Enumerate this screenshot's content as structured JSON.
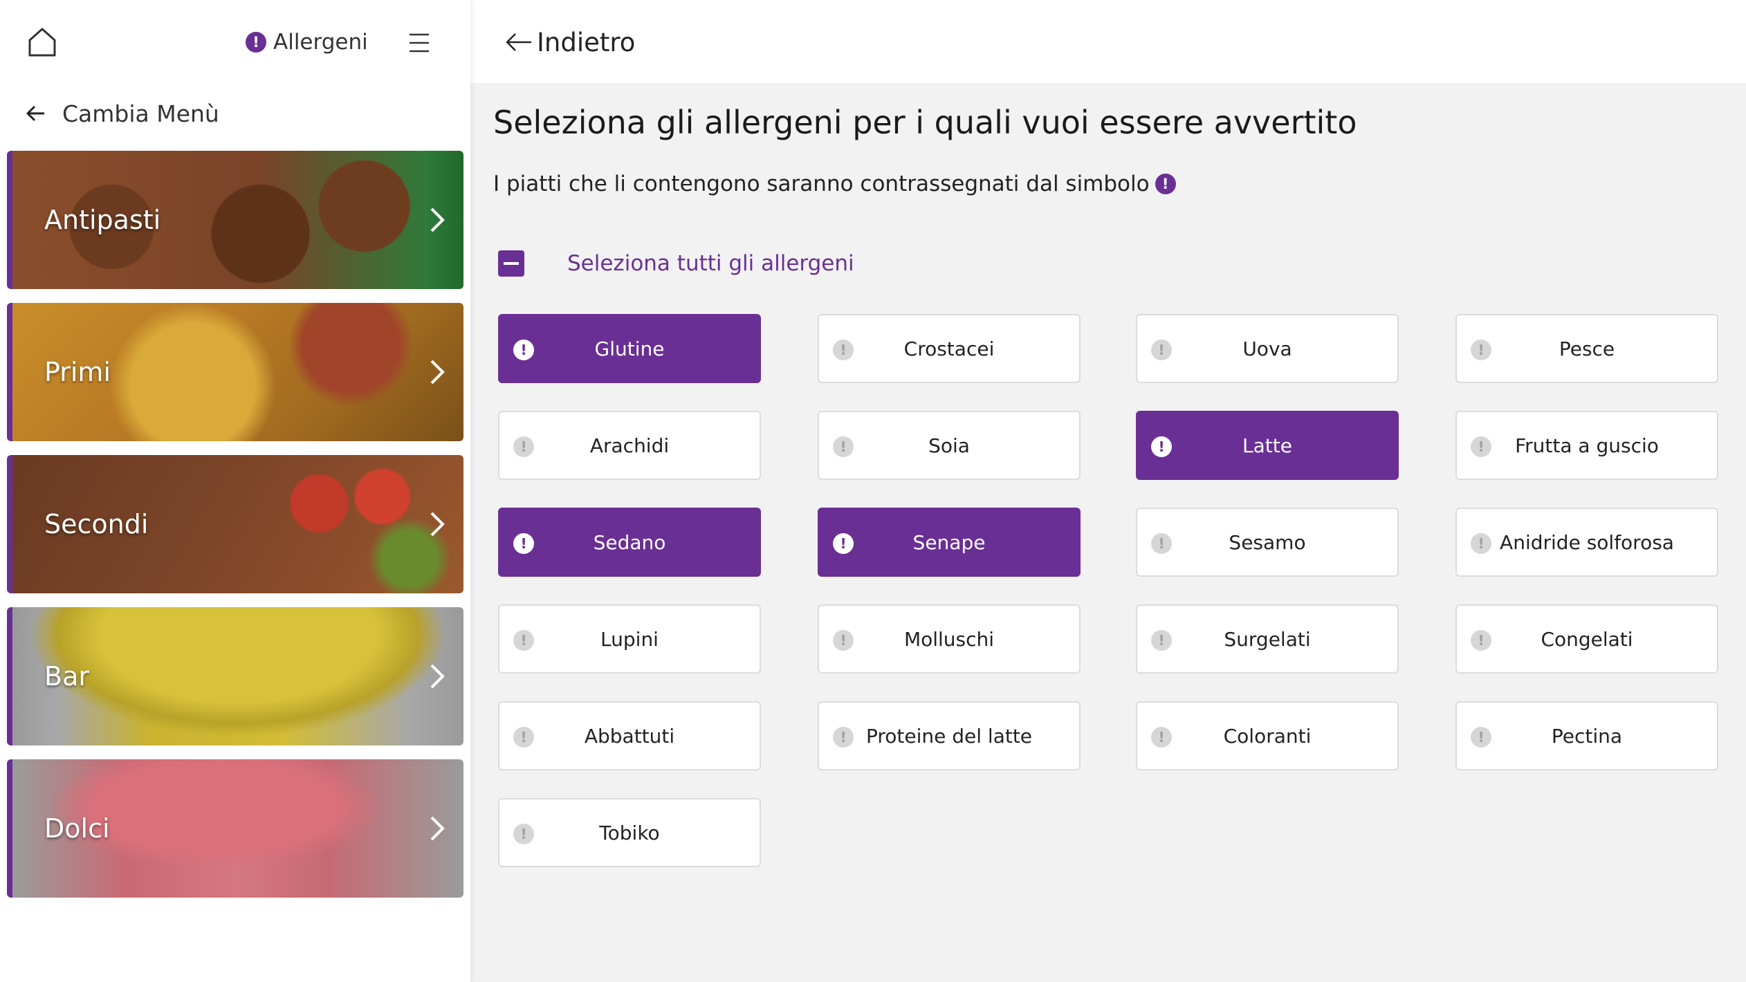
{
  "header": {
    "allergen_link_label": "Allergeni",
    "back_label": "Indietro"
  },
  "sidebar": {
    "change_menu_label": "Cambia Menù",
    "categories": [
      {
        "label": "Antipasti"
      },
      {
        "label": "Primi"
      },
      {
        "label": "Secondi"
      },
      {
        "label": "Bar"
      },
      {
        "label": "Dolci"
      }
    ]
  },
  "main": {
    "title": "Seleziona gli allergeni per i quali vuoi essere avvertito",
    "subtitle": "I piatti che li contengono saranno contrassegnati dal simbolo",
    "select_all_label": "Seleziona tutti gli allergeni",
    "allergens": [
      {
        "label": "Glutine",
        "selected": true
      },
      {
        "label": "Crostacei",
        "selected": false
      },
      {
        "label": "Uova",
        "selected": false
      },
      {
        "label": "Pesce",
        "selected": false
      },
      {
        "label": "Arachidi",
        "selected": false
      },
      {
        "label": "Soia",
        "selected": false
      },
      {
        "label": "Latte",
        "selected": true
      },
      {
        "label": "Frutta a guscio",
        "selected": false
      },
      {
        "label": "Sedano",
        "selected": true
      },
      {
        "label": "Senape",
        "selected": true
      },
      {
        "label": "Sesamo",
        "selected": false
      },
      {
        "label": "Anidride solforosa",
        "selected": false
      },
      {
        "label": "Lupini",
        "selected": false
      },
      {
        "label": "Molluschi",
        "selected": false
      },
      {
        "label": "Surgelati",
        "selected": false
      },
      {
        "label": "Congelati",
        "selected": false
      },
      {
        "label": "Abbattuti",
        "selected": false
      },
      {
        "label": "Proteine del latte",
        "selected": false
      },
      {
        "label": "Coloranti",
        "selected": false
      },
      {
        "label": "Pectina",
        "selected": false
      },
      {
        "label": "Tobiko",
        "selected": false
      }
    ]
  },
  "colors": {
    "accent": "#6a2f94",
    "background": "#f2f2f2",
    "card_border": "#dcdcdc"
  },
  "icons": {
    "home": "home-icon",
    "warning": "exclamation-circle-icon",
    "menu": "hamburger-icon",
    "back": "arrow-left-icon",
    "chevron": "chevron-right-icon"
  }
}
